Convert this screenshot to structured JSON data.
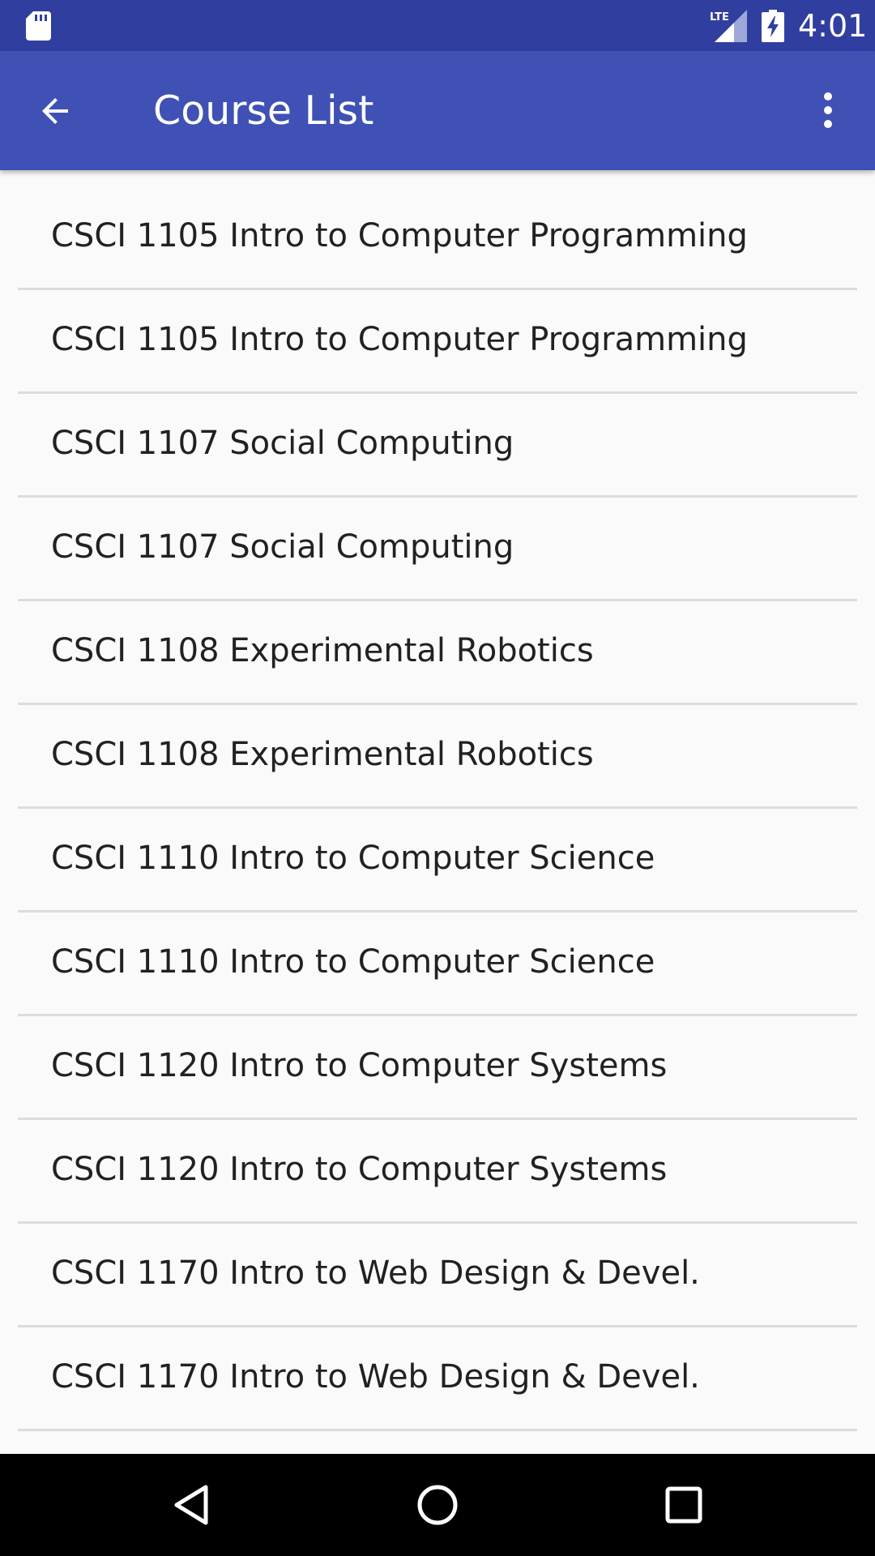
{
  "status_bar": {
    "time": "4:01",
    "network_label": "LTE",
    "icons": [
      "sd-card-icon",
      "lte-signal-icon",
      "battery-charging-icon"
    ]
  },
  "app_bar": {
    "title": "Course List",
    "back_icon": "arrow-back-icon",
    "menu_icon": "more-vert-icon"
  },
  "courses": [
    "CSCI 1105 Intro to Computer Programming",
    "CSCI 1105 Intro to Computer Programming",
    "CSCI 1107 Social Computing",
    "CSCI 1107 Social Computing",
    "CSCI 1108 Experimental Robotics",
    "CSCI 1108 Experimental Robotics",
    "CSCI 1110 Intro to Computer Science",
    "CSCI 1110 Intro to Computer Science",
    "CSCI 1120 Intro to Computer Systems",
    "CSCI 1120 Intro to Computer Systems",
    "CSCI 1170 Intro to Web Design & Devel.",
    "CSCI 1170 Intro to Web Design & Devel."
  ],
  "nav_bar": {
    "icons": [
      "nav-back-icon",
      "nav-home-icon",
      "nav-recents-icon"
    ]
  },
  "colors": {
    "primary": "#3f51b5",
    "primary_dark": "#303f9f",
    "background": "#fafafa",
    "divider": "#dcdcdc",
    "text": "#212121"
  }
}
